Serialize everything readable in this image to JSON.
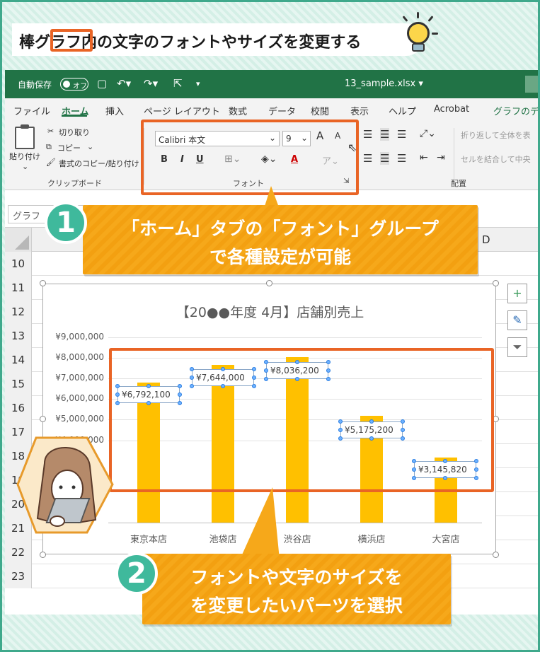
{
  "header": {
    "title": "棒グラフ内の文字のフォントやサイズを変更する"
  },
  "titlebar": {
    "autosave": "自動保存",
    "toggle": "オフ",
    "filename": "13_sample.xlsx ▾"
  },
  "tabs": [
    {
      "label": "ファイル"
    },
    {
      "label": "ホーム"
    },
    {
      "label": "挿入"
    },
    {
      "label": "ページ レイアウト"
    },
    {
      "label": "数式"
    },
    {
      "label": "データ"
    },
    {
      "label": "校閲"
    },
    {
      "label": "表示"
    },
    {
      "label": "ヘルプ"
    },
    {
      "label": "Acrobat"
    },
    {
      "label": "グラフのデザイ"
    }
  ],
  "ribbon": {
    "clipboard": {
      "paste": "貼り付け",
      "cut": "切り取り",
      "copy": "コピー",
      "format_painter": "書式のコピー/貼り付け",
      "label": "クリップボード"
    },
    "font": {
      "font_name": "Calibri 本文",
      "font_size": "9",
      "grow": "A",
      "shrink": "A",
      "bold": "B",
      "italic": "I",
      "underline": "U",
      "font_color": "A",
      "label": "フォント"
    },
    "alignment": {
      "wrap": "折り返して全体を表",
      "merge": "セルを結合して中央",
      "label": "配置"
    }
  },
  "namebox": {
    "value": "グラフ"
  },
  "grid": {
    "col_d": "D",
    "rows": [
      "10",
      "11",
      "12",
      "13",
      "14",
      "15",
      "16",
      "17",
      "18",
      "19",
      "20",
      "21",
      "22",
      "23"
    ]
  },
  "chart_side": {
    "add": "+",
    "style": "✎",
    "filter": "⏷"
  },
  "chart_data": {
    "type": "bar",
    "title": "【20●●年度 4月】店舗別売上",
    "categories": [
      "東京本店",
      "池袋店",
      "渋谷店",
      "横浜店",
      "大宮店"
    ],
    "values": [
      6792100,
      7644000,
      8036200,
      5175200,
      3145820
    ],
    "data_labels": [
      "¥6,792,100",
      "¥7,644,000",
      "¥8,036,200",
      "¥5,175,200",
      "¥3,145,820"
    ],
    "ytick_labels": [
      "¥9,000,000",
      "¥8,000,000",
      "¥7,000,000",
      "¥6,000,000",
      "¥5,000,000",
      "¥4,000,000"
    ],
    "ylim": [
      0,
      9000000
    ],
    "bar_color": "#ffc000"
  },
  "callouts": {
    "one": {
      "num": "1",
      "line1": "「ホーム」タブの「フォント」グループ",
      "line2": "で各種設定が可能"
    },
    "two": {
      "num": "2",
      "line1": "フォントや文字のサイズを",
      "line2": "を変更したいパーツを選択"
    }
  },
  "colors": {
    "accent": "#e96425",
    "excel_green": "#217346",
    "teal": "#3fb99c",
    "callout": "#f6a81a"
  }
}
